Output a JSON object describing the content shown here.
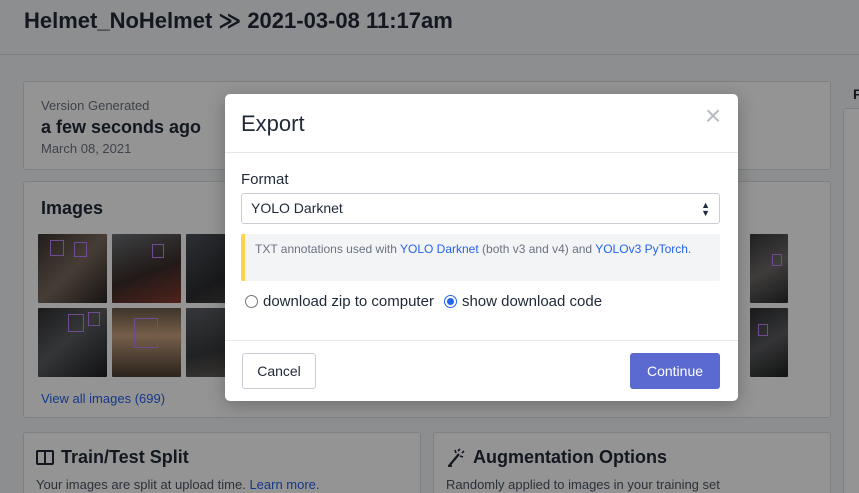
{
  "page": {
    "project": "Helmet_NoHelmet",
    "separator": "≫",
    "version_name": "2021-03-08 11:17am"
  },
  "version_card": {
    "label": "Version Generated",
    "value": "a few seconds ago",
    "date": "March 08, 2021"
  },
  "images_card": {
    "title": "Images",
    "view_all": "View all images (699)"
  },
  "split_card": {
    "title": "Train/Test Split",
    "text": "Your images are split at upload time.",
    "link": "Learn more."
  },
  "aug_card": {
    "title": "Augmentation Options",
    "text": "Randomly applied to images in your training set"
  },
  "right_fragment": "F",
  "modal": {
    "title": "Export",
    "close_glyph": "×",
    "format_label": "Format",
    "format_selected": "YOLO Darknet",
    "info": {
      "pre": "TXT annotations used with ",
      "link1": "YOLO Darknet",
      "mid": " (both v3 and v4) and ",
      "link2": "YOLOv3 PyTorch",
      "post": "."
    },
    "options": [
      {
        "label": "download zip to computer",
        "selected": false
      },
      {
        "label": "show download code",
        "selected": true
      }
    ],
    "cancel": "Cancel",
    "continue": "Continue"
  },
  "colors": {
    "primary_button": "#5b6ad0",
    "link": "#2563eb",
    "info_accent": "#fcd34d"
  }
}
